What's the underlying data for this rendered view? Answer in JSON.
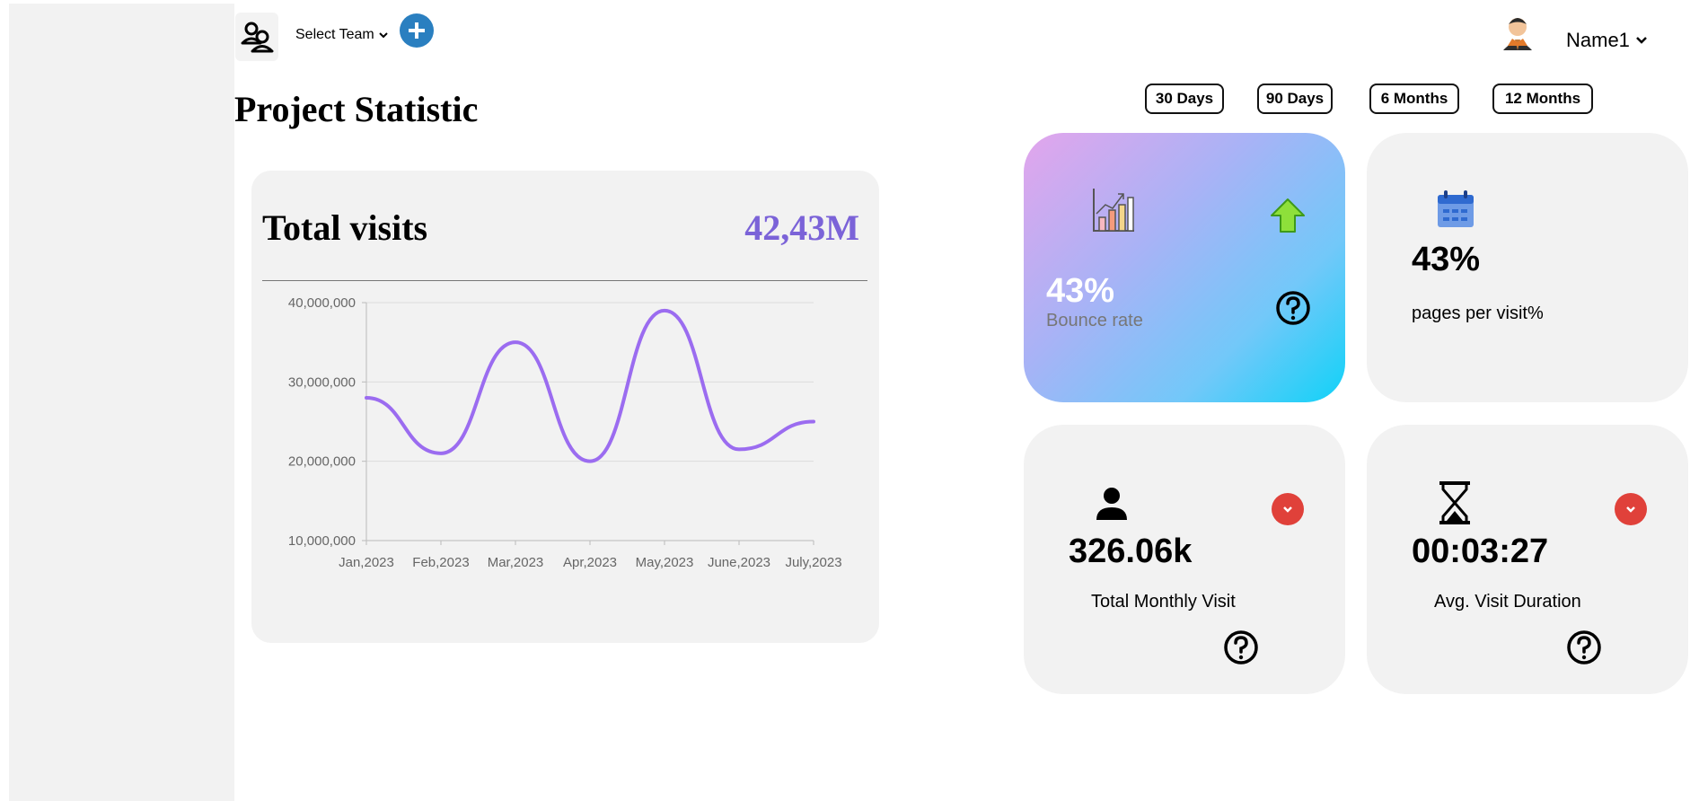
{
  "header": {
    "team_selector_label": "Select Team",
    "user_name": "Name1"
  },
  "page": {
    "title": "Project Statistic"
  },
  "time_ranges": [
    "30 Days",
    "90 Days",
    "6 Months",
    "12 Months"
  ],
  "visits_card": {
    "title": "Total visits",
    "total": "42,43M",
    "line_color": "#9b6cf0"
  },
  "chart_data": {
    "type": "line",
    "categories": [
      "Jan,2023",
      "Feb,2023",
      "Mar,2023",
      "Apr,2023",
      "May,2023",
      "June,2023",
      "July,2023"
    ],
    "series": [
      {
        "values": [
          28000000,
          21000000,
          35000000,
          20000000,
          39000000,
          21500000,
          25000000
        ]
      }
    ],
    "ylim": [
      10000000,
      40000000
    ],
    "yticks": [
      "40,000,000",
      "30,000,000",
      "20,000,000",
      "10,000,000"
    ],
    "grid": true
  },
  "stats": {
    "bounce": {
      "value": "43%",
      "label": "Bounce rate"
    },
    "pages": {
      "value": "43%",
      "label": "pages per visit%"
    },
    "monthly": {
      "value": "326.06k",
      "label": "Total Monthly Visit"
    },
    "duration": {
      "value": "00:03:27",
      "label": "Avg. Visit Duration"
    }
  },
  "icons": {
    "team": "team-icon",
    "add": "plus-circle-icon",
    "user": "user-avatar-icon",
    "bounce": "bar-chart-growth-icon",
    "trend": "up-arrow-icon",
    "pages": "calendar-icon",
    "monthly": "person-icon",
    "duration": "hourglass-icon",
    "help": "question-circle-icon",
    "decrease": "chevron-down-circle-icon"
  }
}
